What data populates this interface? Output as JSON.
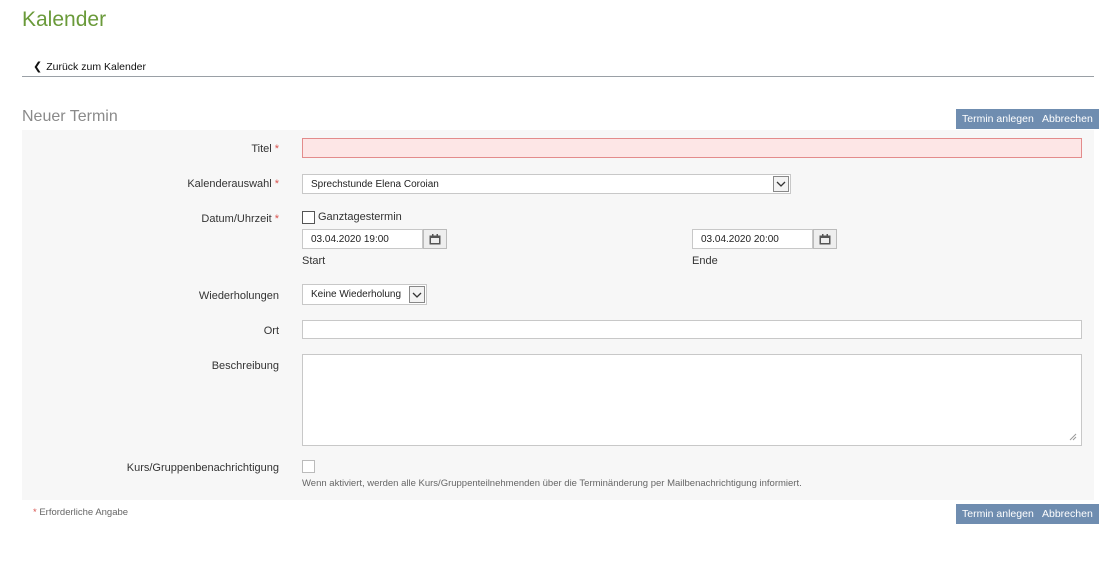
{
  "page": {
    "title": "Kalender",
    "back_link": "Zurück zum Kalender"
  },
  "section": {
    "title": "Neuer Termin"
  },
  "buttons": {
    "create": "Termin anlegen",
    "cancel": "Abbrechen"
  },
  "form": {
    "titel": {
      "label": "Titel",
      "value": ""
    },
    "kalender": {
      "label": "Kalenderauswahl",
      "value": "Sprechstunde Elena Coroian"
    },
    "datum": {
      "label": "Datum/Uhrzeit",
      "allday_label": "Ganztagestermin",
      "allday_checked": false,
      "start_value": "03.04.2020 19:00",
      "start_label": "Start",
      "end_value": "03.04.2020 20:00",
      "end_label": "Ende"
    },
    "wiederholungen": {
      "label": "Wiederholungen",
      "value": "Keine Wiederholung"
    },
    "ort": {
      "label": "Ort",
      "value": ""
    },
    "beschreibung": {
      "label": "Beschreibung",
      "value": ""
    },
    "benachrichtigung": {
      "label": "Kurs/Gruppenbenachrichtigung",
      "checked": false,
      "hint": "Wenn aktiviert, werden alle Kurs/Gruppenteilnehmenden über die Terminänderung per Mailbenachrichtigung informiert."
    },
    "required_marker": "*"
  },
  "footer": {
    "required_note": "Erforderliche Angabe"
  },
  "colors": {
    "title_green": "#6a9a3a",
    "button_blue": "#6f8db0",
    "required_red": "#d9534f",
    "error_bg": "#fde6e6"
  },
  "icons": {
    "back": "chevron-left-icon",
    "dropdown": "chevron-down-icon",
    "calendar": "calendar-icon",
    "resize": "resize-handle-icon"
  }
}
